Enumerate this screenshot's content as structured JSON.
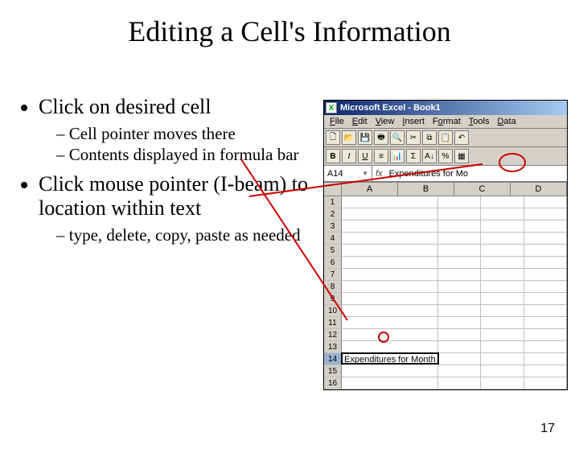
{
  "title": "Editing a Cell's Information",
  "bullets": {
    "b1": "Click on desired cell",
    "b1a": "Cell pointer moves there",
    "b1b": "Contents displayed in formula bar",
    "b2": "Click mouse pointer (I-beam) to location within text",
    "b2a": "type, delete, copy, paste as needed"
  },
  "excel": {
    "title": "Microsoft Excel - Book1",
    "menu": [
      "File",
      "Edit",
      "View",
      "Insert",
      "Format",
      "Tools",
      "Data"
    ],
    "namebox": "A14",
    "fx_label": "fx",
    "formula": "Expenditures for Mo",
    "colheaders": [
      "A",
      "B",
      "C",
      "D"
    ],
    "rows": 16,
    "active_row": 14,
    "cell_text": "Expenditures for Month"
  },
  "page_number": "17"
}
